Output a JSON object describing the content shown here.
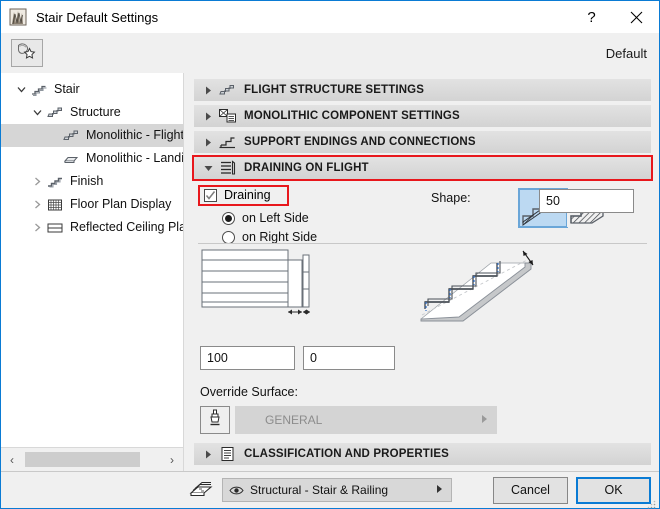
{
  "window": {
    "title": "Stair Default Settings",
    "app_icon": "stair-icon",
    "help_label": "?",
    "close_label": "✕"
  },
  "toolbar": {
    "favorites_icon": "favorites-star-icon",
    "default_label": "Default"
  },
  "sidebar": {
    "items": [
      {
        "label": "Stair",
        "icon": "stair-icon",
        "indent": 0,
        "twisty": "open",
        "selected": false
      },
      {
        "label": "Structure",
        "icon": "structure-icon",
        "indent": 1,
        "twisty": "open",
        "selected": false
      },
      {
        "label": "Monolithic - Flight",
        "icon": "monolithic-flight-icon",
        "indent": 2,
        "twisty": "none",
        "selected": true
      },
      {
        "label": "Monolithic - Landin",
        "icon": "monolithic-landing-icon",
        "indent": 2,
        "twisty": "none",
        "selected": false
      },
      {
        "label": "Finish",
        "icon": "finish-icon",
        "indent": 1,
        "twisty": "closed",
        "selected": false
      },
      {
        "label": "Floor Plan Display",
        "icon": "floor-plan-display-icon",
        "indent": 1,
        "twisty": "closed",
        "selected": false
      },
      {
        "label": "Reflected Ceiling Plan",
        "icon": "reflected-ceiling-plan-icon",
        "indent": 1,
        "twisty": "closed",
        "selected": false
      }
    ],
    "scroll_left_arrow": "‹",
    "scroll_right_arrow": "›"
  },
  "panels": [
    {
      "label": "FLIGHT STRUCTURE SETTINGS",
      "icon": "flight-structure-icon",
      "expanded": false,
      "highlight": false
    },
    {
      "label": "MONOLITHIC COMPONENT SETTINGS",
      "icon": "monolithic-component-icon",
      "expanded": false,
      "highlight": false
    },
    {
      "label": "SUPPORT ENDINGS AND CONNECTIONS",
      "icon": "support-endings-icon",
      "expanded": false,
      "highlight": false
    },
    {
      "label": "DRAINING ON FLIGHT",
      "icon": "draining-icon",
      "expanded": true,
      "highlight": true
    }
  ],
  "bottom_panel": {
    "label": "CLASSIFICATION AND PROPERTIES",
    "icon": "classification-icon",
    "expanded": false
  },
  "draining": {
    "checkbox_label": "Draining",
    "checkbox_checked": true,
    "checkbox_highlight": true,
    "side_options": [
      {
        "label": "on Left Side",
        "selected": true
      },
      {
        "label": "on Right Side",
        "selected": false
      }
    ],
    "shape_label": "Shape:",
    "shape_options": [
      {
        "name": "shape-option-stepped-underside",
        "selected": true
      },
      {
        "name": "shape-option-hatched-underside",
        "selected": false
      }
    ],
    "fields": {
      "width": "100",
      "offset": "0",
      "depth": "50"
    },
    "override_surface_label": "Override Surface:",
    "surface_swatch_icon": "paint-brush-icon",
    "surface_value": "GENERAL",
    "surface_arrow": "▸"
  },
  "footer": {
    "layers_icon": "layers-icon",
    "layer_eye_icon": "eye-icon",
    "layer_value": "Structural - Stair & Railing",
    "layer_arrow": "▸",
    "cancel_label": "Cancel",
    "ok_label": "OK"
  },
  "colors": {
    "accent_blue": "#0a7bd4",
    "highlight_red": "#e8171c",
    "panel_header_gray": "#d9d9d9",
    "selection_gray": "#d6d6d6",
    "shape_selected_fill": "#bcd9f2"
  }
}
